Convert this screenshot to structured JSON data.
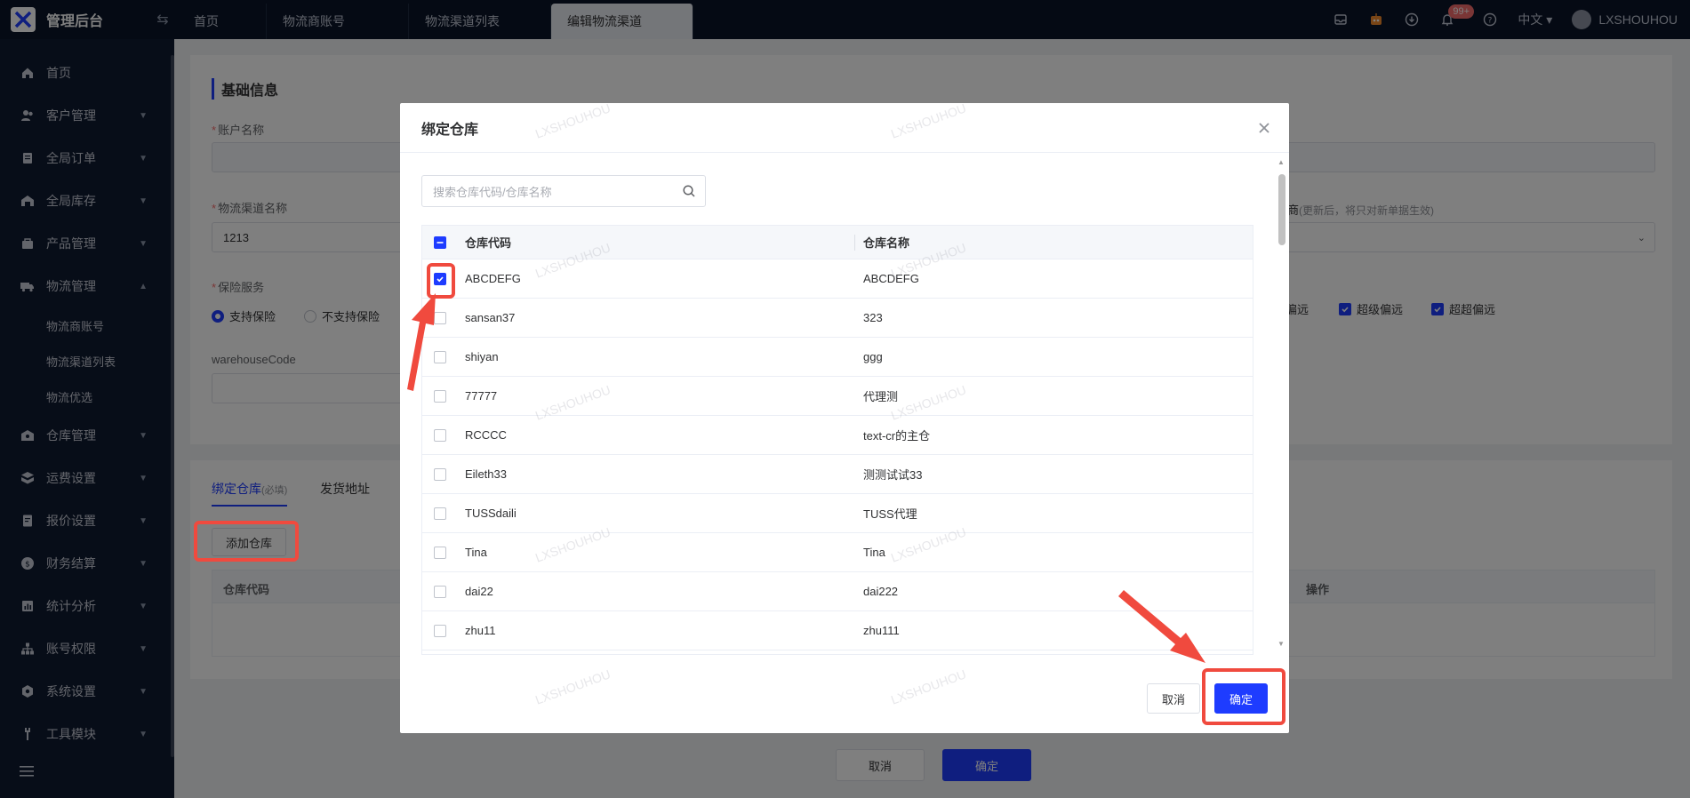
{
  "app": {
    "title": "管理后台"
  },
  "topbar": {
    "tabs": [
      {
        "label": "首页"
      },
      {
        "label": "物流商账号"
      },
      {
        "label": "物流渠道列表"
      },
      {
        "label": "编辑物流渠道"
      }
    ],
    "badge": "99+",
    "lang": "中文",
    "username": "LXSHOUHOU"
  },
  "sidebar": {
    "items": [
      {
        "label": "首页",
        "icon": "home-icon"
      },
      {
        "label": "客户管理",
        "icon": "users-icon"
      },
      {
        "label": "全局订单",
        "icon": "order-icon"
      },
      {
        "label": "全局库存",
        "icon": "inventory-icon"
      },
      {
        "label": "产品管理",
        "icon": "product-icon"
      },
      {
        "label": "物流管理",
        "icon": "truck-icon"
      }
    ],
    "subitems": [
      "物流商账号",
      "物流渠道列表",
      "物流优选"
    ],
    "items2": [
      {
        "label": "仓库管理",
        "icon": "warehouse-icon"
      },
      {
        "label": "运费设置",
        "icon": "freight-icon"
      },
      {
        "label": "报价设置",
        "icon": "quote-icon"
      },
      {
        "label": "财务结算",
        "icon": "finance-icon"
      },
      {
        "label": "统计分析",
        "icon": "stats-icon"
      },
      {
        "label": "账号权限",
        "icon": "permission-icon"
      },
      {
        "label": "系统设置",
        "icon": "settings-icon"
      },
      {
        "label": "工具模块",
        "icon": "tools-icon"
      }
    ]
  },
  "background": {
    "section_title": "基础信息",
    "account_label": "账户名称",
    "channel_label": "物流渠道名称",
    "channel_value": "1213",
    "insurance_label": "保险服务",
    "insurance_yes": "支持保险",
    "insurance_no": "不支持保险",
    "warehouse_code_label": "warehouseCode",
    "right_label_frag": "商",
    "right_label_hint": "(更新后，将只对新单据生效)",
    "check1": "偏远",
    "check2": "超级偏远",
    "check3": "超超偏远",
    "subtab_bind": "绑定仓库",
    "subtab_bind_hint": "(必填)",
    "subtab_address": "发货地址",
    "add_warehouse": "添加仓库",
    "th_code": "仓库代码",
    "th_action": "操作",
    "cancel": "取消",
    "confirm": "确定"
  },
  "modal": {
    "title": "绑定仓库",
    "search_placeholder": "搜索仓库代码/仓库名称",
    "columns": {
      "code": "仓库代码",
      "name": "仓库名称"
    },
    "rows": [
      {
        "code": "ABCDEFG",
        "name": "ABCDEFG",
        "checked": true
      },
      {
        "code": "sansan37",
        "name": "323",
        "checked": false
      },
      {
        "code": "shiyan",
        "name": "ggg",
        "checked": false
      },
      {
        "code": "77777",
        "name": "代理测",
        "checked": false
      },
      {
        "code": "RCCCC",
        "name": "text-cr的主仓",
        "checked": false
      },
      {
        "code": "Eileth33",
        "name": "测测试试33",
        "checked": false
      },
      {
        "code": "TUSSdaili",
        "name": "TUSS代理",
        "checked": false
      },
      {
        "code": "Tina",
        "name": "Tina",
        "checked": false
      },
      {
        "code": "dai22",
        "name": "dai222",
        "checked": false
      },
      {
        "code": "zhu11",
        "name": "zhu111",
        "checked": false
      }
    ],
    "cancel": "取消",
    "confirm": "确定"
  },
  "colors": {
    "primary": "#1e3cff",
    "annotation": "#f04a3e",
    "sidebar_bg": "#0f1a30"
  }
}
